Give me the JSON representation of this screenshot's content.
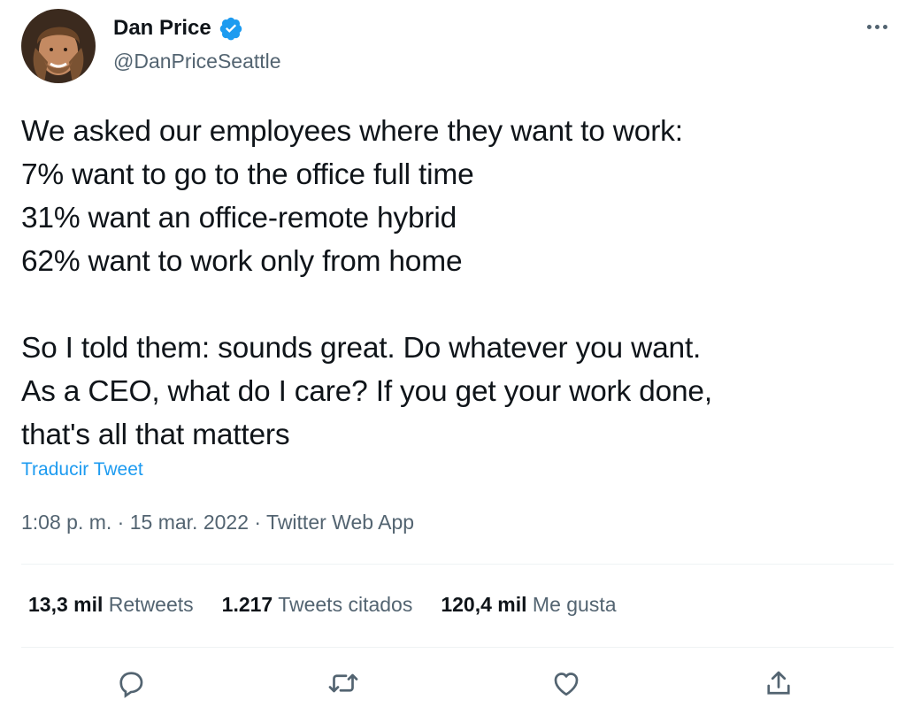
{
  "author": {
    "display_name": "Dan Price",
    "handle": "@DanPriceSeattle",
    "verified_icon": "verified-badge-icon"
  },
  "tweet": {
    "lines_part1": [
      "We asked our employees where they want to work:",
      "7% want to go to the office full time",
      "31% want an office-remote hybrid",
      "62% want to work only from home"
    ],
    "lines_part2": [
      "So I told them: sounds great. Do whatever you want.",
      "As a CEO, what do I care? If you get your work done,",
      "that's all that matters"
    ],
    "translate_label": "Traducir Tweet",
    "time": "1:08 p. m.",
    "date": "15 mar. 2022",
    "client": "Twitter Web App",
    "separator": "·"
  },
  "stats": {
    "retweets": {
      "count": "13,3 mil",
      "label": "Retweets"
    },
    "quotes": {
      "count": "1.217",
      "label": "Tweets citados"
    },
    "likes": {
      "count": "120,4 mil",
      "label": "Me gusta"
    }
  },
  "actions": [
    "reply-icon",
    "retweet-icon",
    "like-icon",
    "share-icon"
  ],
  "colors": {
    "accent": "#1d9bf0",
    "secondary_text": "#536471",
    "primary_text": "#0f1419"
  }
}
